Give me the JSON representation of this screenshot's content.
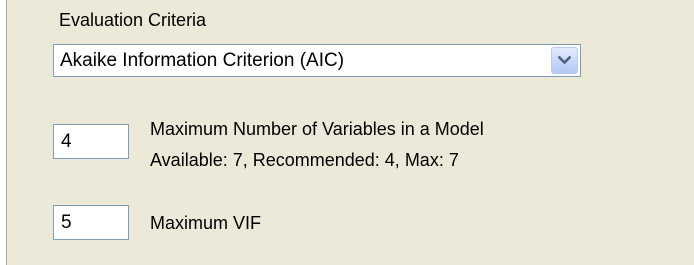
{
  "evaluation_criteria": {
    "label": "Evaluation Criteria",
    "selected": "Akaike Information Criterion (AIC)",
    "dropdown_icon": "chevron-down-icon"
  },
  "max_variables": {
    "value": "4",
    "label": "Maximum Number of Variables in a Model",
    "info": "Available: 7, Recommended: 4, Max: 7"
  },
  "max_vif": {
    "value": "5",
    "label": "Maximum VIF"
  },
  "colors": {
    "background": "#ece9d8",
    "field_border": "#7f9db9",
    "dropdown_arrow": "#4d6185"
  }
}
